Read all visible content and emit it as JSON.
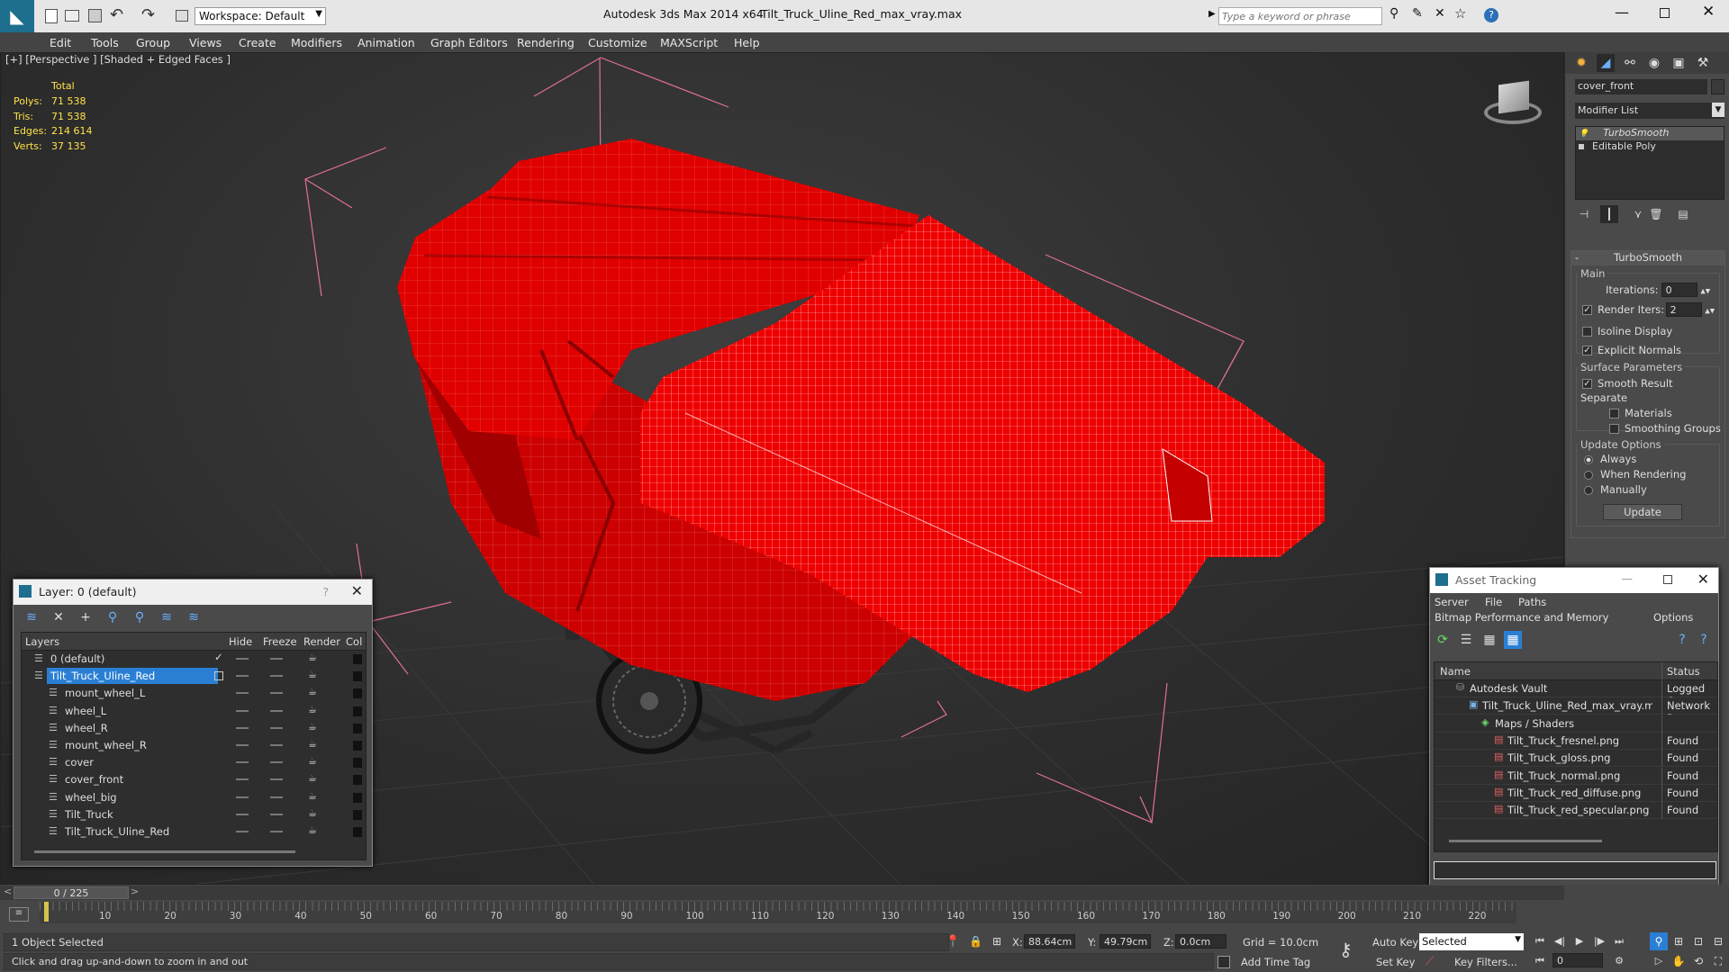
{
  "window": {
    "app_title": "Autodesk 3ds Max  2014 x64",
    "file_title": "Tilt_Truck_Uline_Red_max_vray.max",
    "workspace": "Workspace: Default",
    "search_placeholder": "Type a keyword or phrase"
  },
  "menu": [
    "Edit",
    "Tools",
    "Group",
    "Views",
    "Create",
    "Modifiers",
    "Animation",
    "Graph Editors",
    "Rendering",
    "Customize",
    "MAXScript",
    "Help"
  ],
  "viewport": {
    "label": "[+] [Perspective ] [Shaded + Edged Faces ]",
    "stats_header": "Total",
    "stats": [
      {
        "label": "Polys:",
        "value": "71 538"
      },
      {
        "label": "Tris:",
        "value": "71 538"
      },
      {
        "label": "Edges:",
        "value": "214 614"
      },
      {
        "label": "Verts:",
        "value": "37 135"
      }
    ]
  },
  "command_panel": {
    "object_name": "cover_front",
    "modifier_list": "Modifier List",
    "stack": [
      "TurboSmooth",
      "Editable Poly"
    ],
    "rollout_title": "TurboSmooth",
    "main_label": "Main",
    "iterations_label": "Iterations:",
    "iterations_value": "0",
    "render_iters_label": "Render Iters:",
    "render_iters_value": "2",
    "isoline": "Isoline Display",
    "explicit_normals": "Explicit Normals",
    "surface_params": "Surface Parameters",
    "smooth_result": "Smooth Result",
    "separate": "Separate",
    "materials": "Materials",
    "smoothing_groups": "Smoothing Groups",
    "update_options": "Update Options",
    "always": "Always",
    "when_rendering": "When Rendering",
    "manually": "Manually",
    "update_btn": "Update"
  },
  "layer_dialog": {
    "title": "Layer: 0 (default)",
    "help": "?",
    "columns": [
      "Layers",
      "Hide",
      "Freeze",
      "Render",
      "Col"
    ],
    "rows": [
      {
        "name": "0 (default)",
        "indent": 0,
        "selected": false,
        "current": true
      },
      {
        "name": "Tilt_Truck_Uline_Red",
        "indent": 0,
        "selected": true,
        "current": false
      },
      {
        "name": "mount_wheel_L",
        "indent": 1,
        "selected": false,
        "current": false
      },
      {
        "name": "wheel_L",
        "indent": 1,
        "selected": false,
        "current": false
      },
      {
        "name": "wheel_R",
        "indent": 1,
        "selected": false,
        "current": false
      },
      {
        "name": "mount_wheel_R",
        "indent": 1,
        "selected": false,
        "current": false
      },
      {
        "name": "cover",
        "indent": 1,
        "selected": false,
        "current": false
      },
      {
        "name": "cover_front",
        "indent": 1,
        "selected": false,
        "current": false
      },
      {
        "name": "wheel_big",
        "indent": 1,
        "selected": false,
        "current": false
      },
      {
        "name": "Tilt_Truck",
        "indent": 1,
        "selected": false,
        "current": false
      },
      {
        "name": "Tilt_Truck_Uline_Red",
        "indent": 1,
        "selected": false,
        "current": false
      }
    ]
  },
  "asset_tracking": {
    "title": "Asset Tracking",
    "menu1": [
      "Server",
      "File",
      "Paths"
    ],
    "menu2": [
      "Bitmap Performance and Memory",
      "Options"
    ],
    "col_name": "Name",
    "col_status": "Status",
    "rows": [
      {
        "name": "Autodesk Vault",
        "status": "Logged Ou",
        "indent": 1,
        "icon": "vault"
      },
      {
        "name": "Tilt_Truck_Uline_Red_max_vray.max",
        "status": "Network P",
        "indent": 2,
        "icon": "max"
      },
      {
        "name": "Maps / Shaders",
        "status": "",
        "indent": 3,
        "icon": "maps"
      },
      {
        "name": "Tilt_Truck_fresnel.png",
        "status": "Found",
        "indent": 4,
        "icon": "png"
      },
      {
        "name": "Tilt_Truck_gloss.png",
        "status": "Found",
        "indent": 4,
        "icon": "png"
      },
      {
        "name": "Tilt_Truck_normal.png",
        "status": "Found",
        "indent": 4,
        "icon": "png"
      },
      {
        "name": "Tilt_Truck_red_diffuse.png",
        "status": "Found",
        "indent": 4,
        "icon": "png"
      },
      {
        "name": "Tilt_Truck_red_specular.png",
        "status": "Found",
        "indent": 4,
        "icon": "png"
      }
    ]
  },
  "timeline": {
    "frame": "0 / 225",
    "ticks": [
      "10",
      "20",
      "30",
      "40",
      "50",
      "60",
      "70",
      "80",
      "90",
      "100",
      "110",
      "120",
      "130",
      "140",
      "150",
      "160",
      "170",
      "180",
      "190",
      "200",
      "210",
      "220"
    ]
  },
  "status": {
    "selected": "1 Object Selected",
    "prompt": "Click and drag up-and-down to zoom in and out",
    "x_label": "X:",
    "x_value": "88.64cm",
    "y_label": "Y:",
    "y_value": "49.79cm",
    "z_label": "Z:",
    "z_value": "0.0cm",
    "grid": "Grid = 10.0cm",
    "add_time_tag": "Add Time Tag",
    "auto_key": "Auto Key",
    "set_key": "Set Key",
    "selected_dropdown": "Selected",
    "key_filters": "Key Filters...",
    "frame_field": "0"
  },
  "colors": {
    "accent": "#2a7fd4",
    "model_red": "#e60000",
    "wire": "#ffffff",
    "bbox": "#e07090"
  }
}
